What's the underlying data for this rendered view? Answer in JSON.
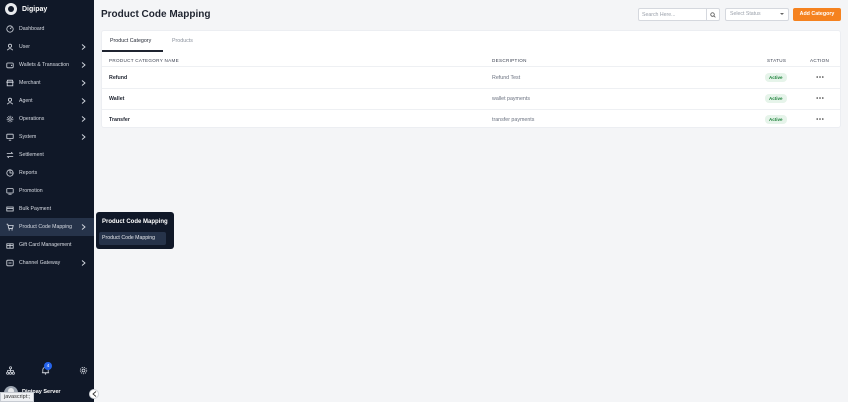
{
  "brand": {
    "name": "Digipay"
  },
  "sidebar": {
    "items": [
      {
        "label": "Dashboard",
        "icon": "dashboard-icon",
        "chevron": false
      },
      {
        "label": "User",
        "icon": "user-icon",
        "chevron": true
      },
      {
        "label": "Wallets & Transaction",
        "icon": "wallet-icon",
        "chevron": true
      },
      {
        "label": "Merchant",
        "icon": "store-icon",
        "chevron": true
      },
      {
        "label": "Agent",
        "icon": "agent-icon",
        "chevron": true
      },
      {
        "label": "Operations",
        "icon": "gear-icon",
        "chevron": true
      },
      {
        "label": "System",
        "icon": "monitor-icon",
        "chevron": true
      },
      {
        "label": "Settlement",
        "icon": "swap-icon",
        "chevron": false
      },
      {
        "label": "Reports",
        "icon": "reports-icon",
        "chevron": false
      },
      {
        "label": "Promotion",
        "icon": "promotion-icon",
        "chevron": false
      },
      {
        "label": "Bulk Payment",
        "icon": "bulk-payment-icon",
        "chevron": false
      },
      {
        "label": "Product Code Mapping",
        "icon": "cart-icon",
        "chevron": true,
        "active": true
      },
      {
        "label": "Gift Card Management",
        "icon": "gift-icon",
        "chevron": false
      },
      {
        "label": "Channel Gateway",
        "icon": "channel-icon",
        "chevron": true
      }
    ],
    "notification_count": "4",
    "user_name": "Digipay Server"
  },
  "flyout": {
    "title": "Product Code Mapping",
    "item": "Product Code Mapping"
  },
  "status_bar": {
    "text": "javascript:;"
  },
  "page": {
    "title": "Product Code Mapping",
    "search_placeholder": "Search Here...",
    "select_status": "Select Status",
    "add_button": "Add Category"
  },
  "tabs": [
    {
      "label": "Product Category",
      "active": true
    },
    {
      "label": "Products",
      "active": false
    }
  ],
  "table": {
    "columns": [
      "PRODUCT CATEGORY NAME",
      "DESCRIPTION",
      "STATUS",
      "ACTION"
    ],
    "rows": [
      {
        "name": "Refund",
        "description": "Refund Test",
        "status": "Active"
      },
      {
        "name": "Wallet",
        "description": "wallet payments",
        "status": "Active"
      },
      {
        "name": "Transfer",
        "description": "transfer payments",
        "status": "Active"
      }
    ]
  },
  "colors": {
    "sidebar_bg": "#101828",
    "accent": "#f5821f",
    "active_badge_bg": "#e6f4ea",
    "active_badge_text": "#1a7f37"
  }
}
